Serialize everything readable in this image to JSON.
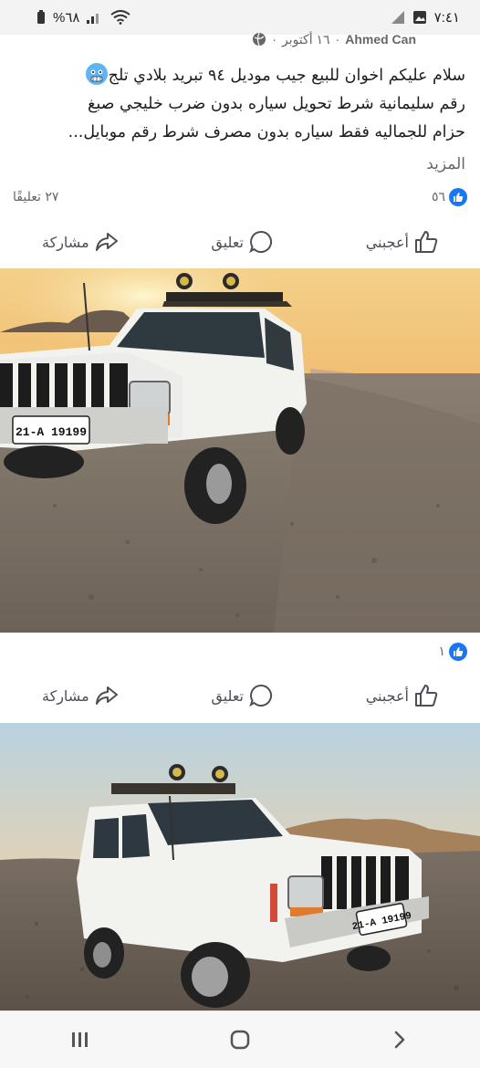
{
  "status_bar": {
    "time": "٧:٤١",
    "battery": "%٦٨",
    "icons": [
      "battery-icon",
      "signal-icon",
      "wifi-icon",
      "sim-icon",
      "gallery-icon"
    ]
  },
  "post": {
    "author": "Ahmed Can",
    "date": "١٦ أكتوبر",
    "separator": "·",
    "privacy_icon": "globe-icon",
    "text_lines": [
      "سلام عليكم اخوان للبيع جيب موديل ٩٤ تبريد بلادي تلج",
      "رقم سليمانية شرط تحويل سياره بدون ضرب خليجي صبغ",
      "حزام للجماليه فقط سياره بدون مصرف شرط رقم موبايل..."
    ],
    "emoji": "cold-face-emoji",
    "more": "المزيد",
    "likes": "٥٦",
    "comments": "٢٧ تعليقًا"
  },
  "actions": {
    "like": "أعجبني",
    "comment": "تعليق",
    "share": "مشاركة"
  },
  "photos": [
    {
      "plate": "21-A 19199",
      "likes": "١",
      "icon": "like-icon"
    },
    {
      "plate": "21-A 19199"
    }
  ],
  "nav": {
    "buttons": [
      "recent-apps-icon",
      "home-icon",
      "back-icon"
    ]
  },
  "colors": {
    "accent": "#1877f2",
    "text": "#1c1e21",
    "muted": "#65676b",
    "car": "#f4f4f2"
  }
}
